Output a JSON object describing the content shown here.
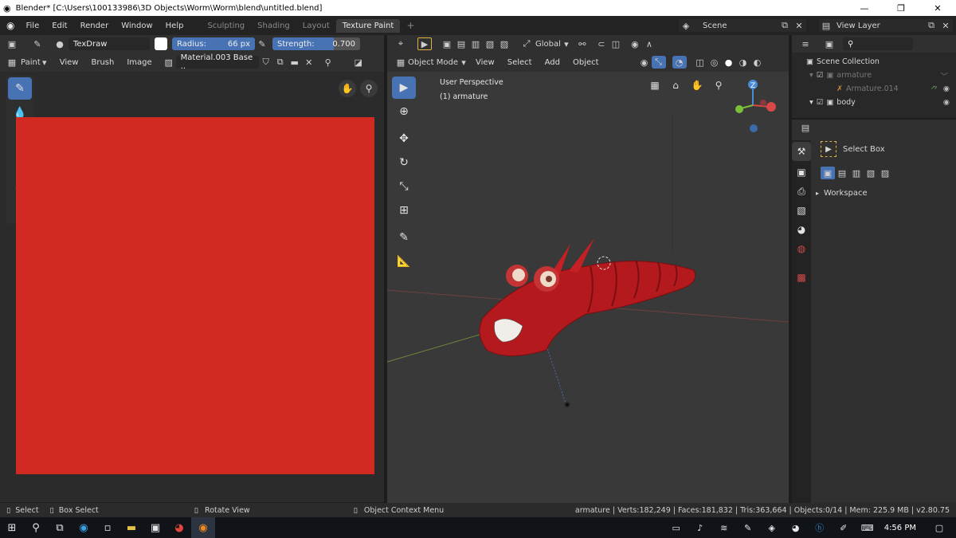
{
  "window": {
    "title": "Blender* [C:\\Users\\100133986\\3D Objects\\Worm\\Worm\\blend\\untitled.blend]",
    "min": "—",
    "max": "❐",
    "close": "✕"
  },
  "menubar": {
    "items": [
      "File",
      "Edit",
      "Render",
      "Window",
      "Help"
    ],
    "workspaces": [
      "Sculpting",
      "Shading",
      "Layout",
      "Texture Paint"
    ],
    "active_workspace": "Texture Paint",
    "add_tab": "+",
    "scene": "Scene",
    "view_layer": "View Layer"
  },
  "image_editor": {
    "brush_name": "TexDraw",
    "radius_label": "Radius:",
    "radius_value": "66 px",
    "strength_label": "Strength:",
    "strength_value": "0.700",
    "mode": "Paint",
    "menus": [
      "View",
      "Brush",
      "Image"
    ],
    "image_name": "Material.003 Base ..",
    "canvas_color": "#d12a22"
  },
  "viewport": {
    "orientation": "Global",
    "mode": "Object Mode",
    "menus": [
      "View",
      "Select",
      "Add",
      "Object"
    ],
    "perspective": "User Perspective",
    "active_object": "(1) armature",
    "gizmo_z": "Z"
  },
  "outliner": {
    "collection": "Scene Collection",
    "rows": [
      {
        "label": "armature",
        "dim": true
      },
      {
        "label": "Armature.014",
        "dim": true
      },
      {
        "label": "body",
        "dim": false
      }
    ]
  },
  "properties": {
    "tool_name": "Select Box",
    "workspace_section": "Workspace"
  },
  "statusbar": {
    "select": "Select",
    "box_select": "Box Select",
    "rotate": "Rotate View",
    "context": "Object Context Menu",
    "stats": "armature | Verts:182,249 | Faces:181,832 | Tris:363,664 | Objects:0/14 | Mem: 225.9 MB | v2.80.75"
  },
  "taskbar": {
    "time": "4:56 PM"
  }
}
